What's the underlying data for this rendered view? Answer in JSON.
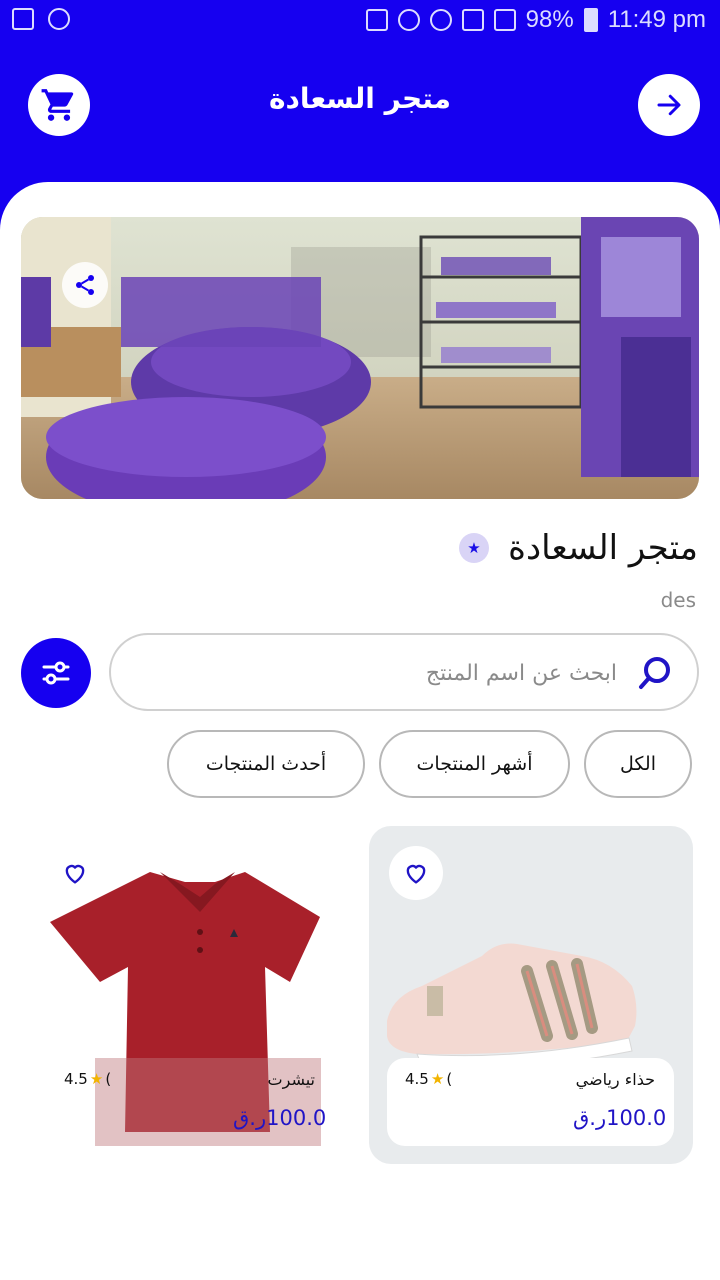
{
  "status_bar": {
    "battery_percent": "98%",
    "time": "11:49 pm"
  },
  "header": {
    "title": "متجر السعادة"
  },
  "store": {
    "name": "متجر السعادة",
    "description": "des"
  },
  "search": {
    "placeholder": "ابحث عن اسم المنتج"
  },
  "filters": {
    "all": "الكل",
    "popular": "أشهر المنتجات",
    "latest": "أحدث المنتجات"
  },
  "products": [
    {
      "name": "حذاء رياضي",
      "rating": "4.5",
      "price": "100.0ر.ق"
    },
    {
      "name": "تيشرت",
      "rating": "4.5",
      "price": "100.0ر.ق"
    }
  ],
  "colors": {
    "primary": "#1600f0",
    "price": "#2014c6",
    "star": "#f2b400"
  }
}
